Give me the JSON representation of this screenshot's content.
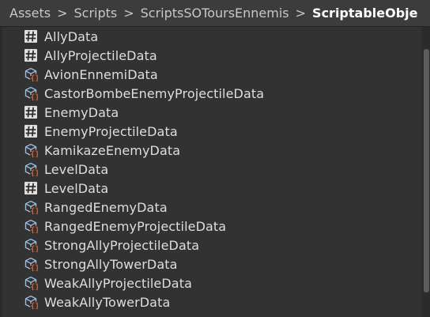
{
  "breadcrumb": {
    "items": [
      "Assets",
      "Scripts",
      "ScriptsSOToursEnnemis",
      "ScriptableObje"
    ],
    "separator": ">"
  },
  "colors": {
    "background": "#323232",
    "text": "#dedede",
    "script_icon_bg": "#e0e0e0",
    "so_icon_outline": "#9fc3e8",
    "so_icon_braces": "#e0612f"
  },
  "files": [
    {
      "name": "AllyData",
      "icon": "csharp-script-icon"
    },
    {
      "name": "AllyProjectileData",
      "icon": "csharp-script-icon"
    },
    {
      "name": "AvionEnnemiData",
      "icon": "scriptable-object-icon"
    },
    {
      "name": "CastorBombeEnemyProjectileData",
      "icon": "scriptable-object-icon"
    },
    {
      "name": "EnemyData",
      "icon": "csharp-script-icon"
    },
    {
      "name": "EnemyProjectileData",
      "icon": "csharp-script-icon"
    },
    {
      "name": "KamikazeEnemyData",
      "icon": "scriptable-object-icon"
    },
    {
      "name": "LevelData",
      "icon": "scriptable-object-icon"
    },
    {
      "name": "LevelData",
      "icon": "csharp-script-icon"
    },
    {
      "name": "RangedEnemyData",
      "icon": "scriptable-object-icon"
    },
    {
      "name": "RangedEnemyProjectileData",
      "icon": "scriptable-object-icon"
    },
    {
      "name": "StrongAllyProjectileData",
      "icon": "scriptable-object-icon"
    },
    {
      "name": "StrongAllyTowerData",
      "icon": "scriptable-object-icon"
    },
    {
      "name": "WeakAllyProjectileData",
      "icon": "scriptable-object-icon"
    },
    {
      "name": "WeakAllyTowerData",
      "icon": "scriptable-object-icon"
    }
  ]
}
